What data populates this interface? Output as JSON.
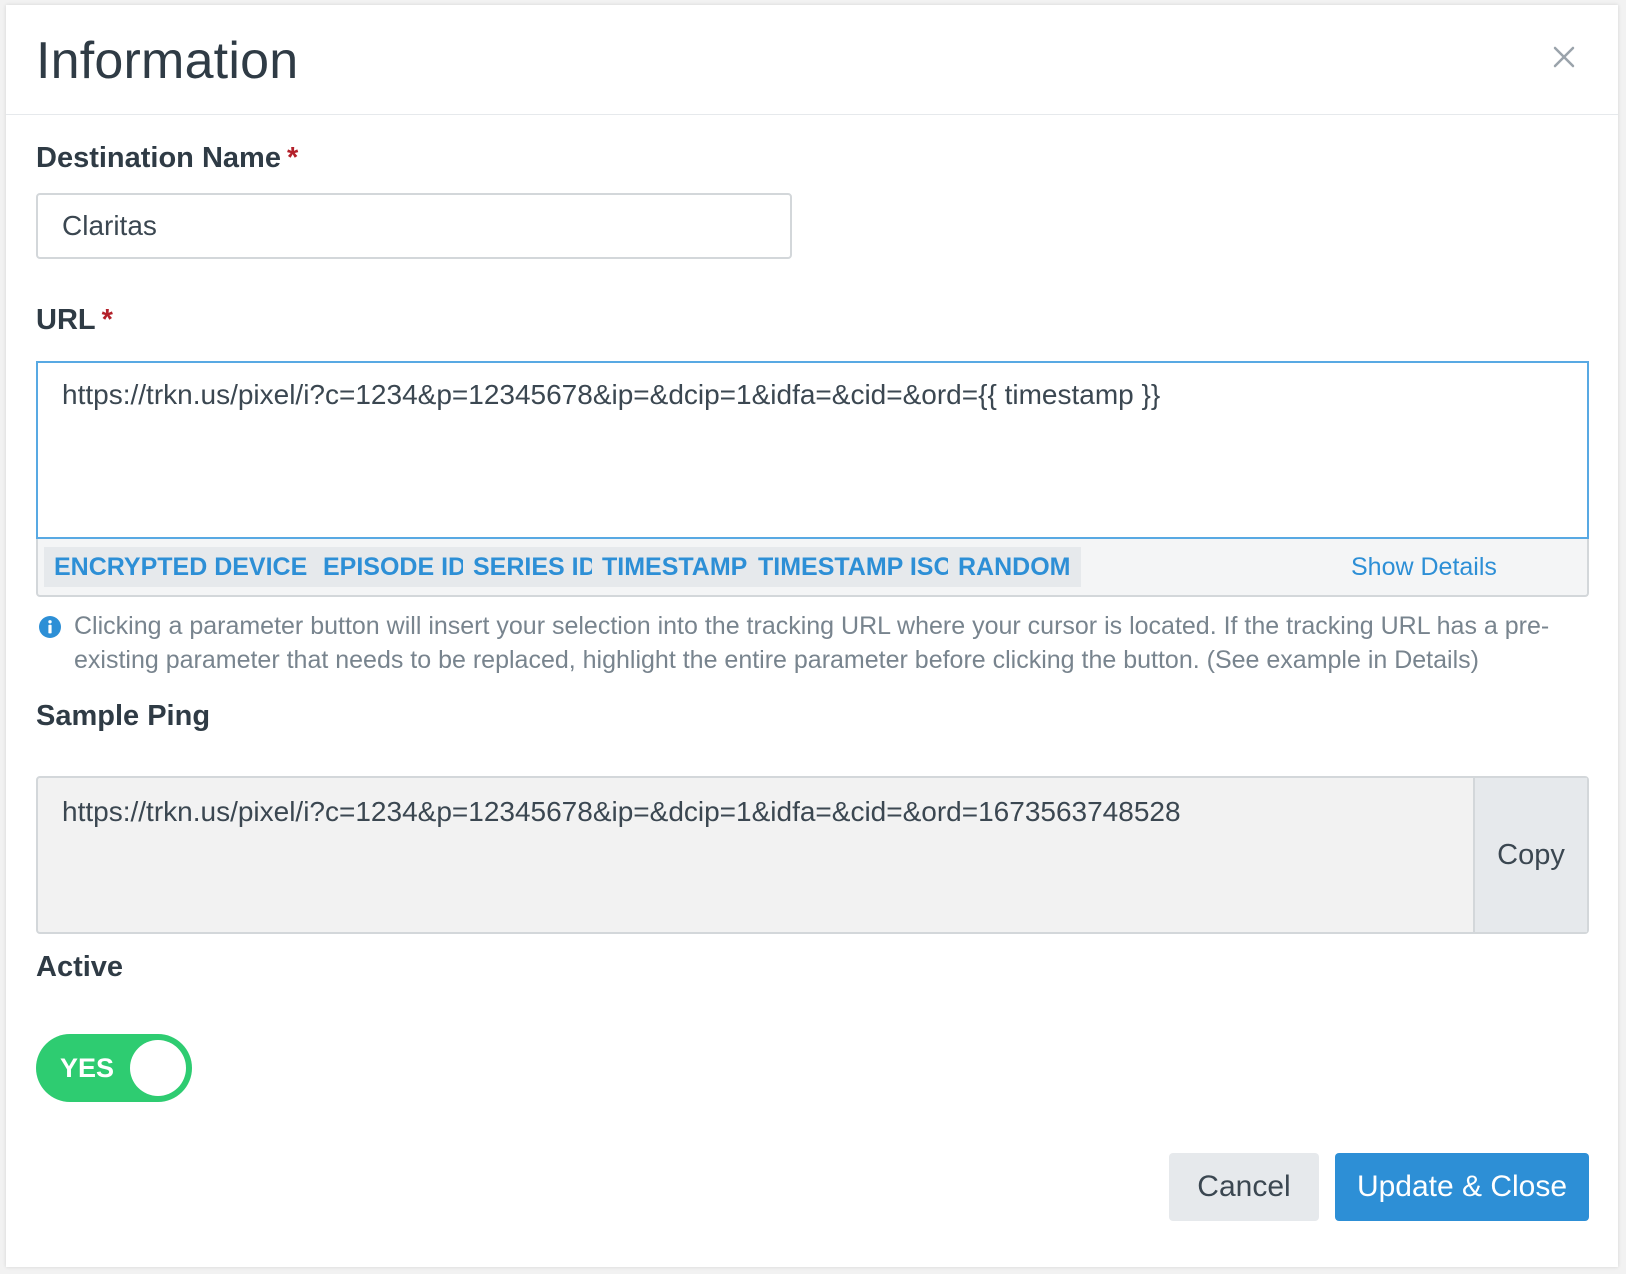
{
  "modal": {
    "title": "Information"
  },
  "destination_name": {
    "label": "Destination Name",
    "required_marker": "*",
    "value": "Claritas"
  },
  "url": {
    "label": "URL",
    "required_marker": "*",
    "value": "https://trkn.us/pixel/i?c=1234&p=12345678&ip=&dcip=1&idfa=&cid=&ord={{ timestamp }}",
    "parameter_buttons": [
      {
        "label": "ENCRYPTED DEVICE IP"
      },
      {
        "label": "EPISODE ID"
      },
      {
        "label": "SERIES ID"
      },
      {
        "label": "TIMESTAMP"
      },
      {
        "label": "TIMESTAMP ISO"
      },
      {
        "label": "RANDOM"
      }
    ],
    "show_details_label": "Show Details",
    "help_text": "Clicking a parameter button will insert your selection into the tracking URL where your cursor is located. If the tracking URL has a pre-existing parameter that needs to be replaced, highlight the entire parameter before clicking the button. (See example in Details)"
  },
  "sample_ping": {
    "label": "Sample Ping",
    "value": "https://trkn.us/pixel/i?c=1234&p=12345678&ip=&dcip=1&idfa=&cid=&ord=1673563748528",
    "copy_label": "Copy"
  },
  "active": {
    "label": "Active",
    "toggle_label": "YES",
    "on": true
  },
  "footer": {
    "cancel_label": "Cancel",
    "submit_label": "Update & Close"
  },
  "colors": {
    "accent": "#2d8fd6",
    "toggle_on": "#2ecc71",
    "required": "#b3202a"
  },
  "icons": {
    "close": "close-icon",
    "info": "info-icon"
  }
}
